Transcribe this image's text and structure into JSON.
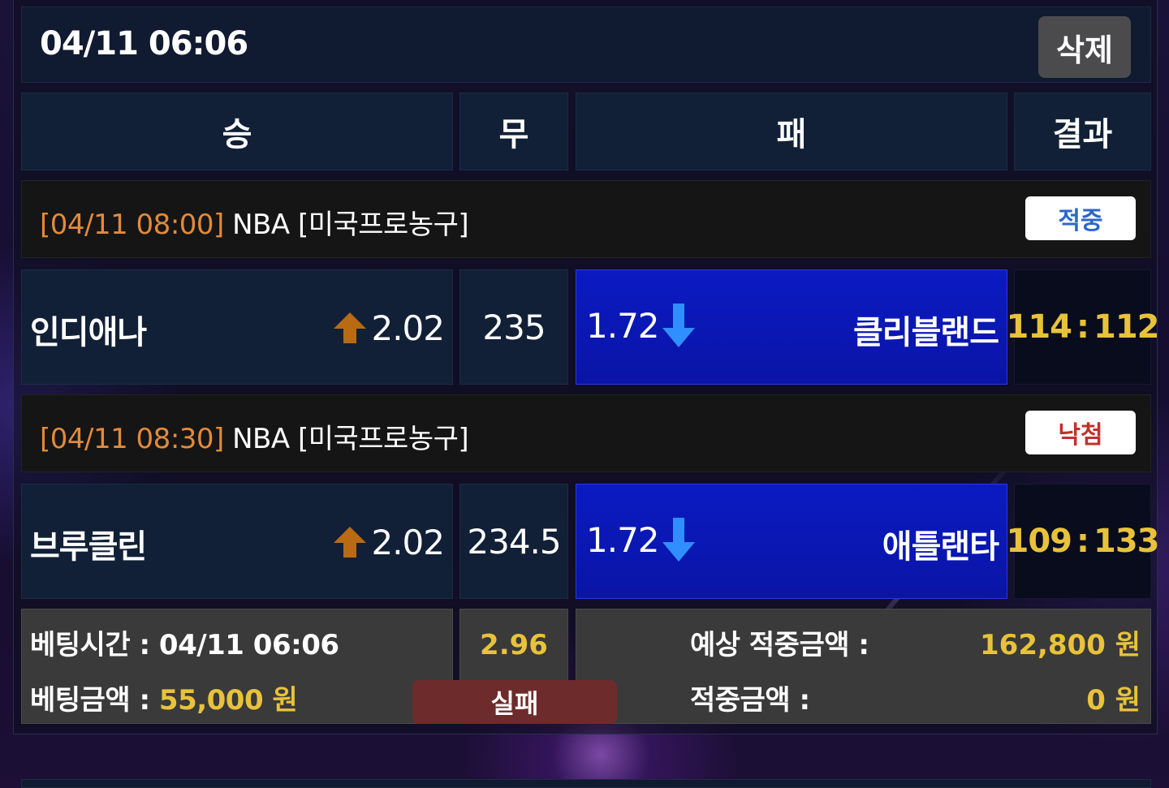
{
  "header": {
    "bet_datetime": "04/11 06:06",
    "delete_label": "삭제"
  },
  "columns": {
    "win": "승",
    "draw": "무",
    "lose": "패",
    "result": "결과"
  },
  "games": [
    {
      "kickoff": "[04/11 08:00]",
      "league": "NBA [미국프로농구]",
      "badge": "적중",
      "home_team": "인디애나",
      "home_odds": "2.02",
      "home_arrow": "up-arrow-icon",
      "line": "235",
      "away_odds": "1.72",
      "away_arrow": "down-arrow-icon",
      "away_team": "클리블랜드",
      "score_home": "114",
      "score_sep": ":",
      "score_away": "112",
      "selected": "away"
    },
    {
      "kickoff": "[04/11 08:30]",
      "league": "NBA [미국프로농구]",
      "badge": "낙첨",
      "home_team": "브루클린",
      "home_odds": "2.02",
      "home_arrow": "up-arrow-icon",
      "line": "234.5",
      "away_odds": "1.72",
      "away_arrow": "down-arrow-icon",
      "away_team": "애틀랜타",
      "score_home": "109",
      "score_sep": ":",
      "score_away": "133",
      "selected": "away"
    }
  ],
  "summary": {
    "bet_time_label": "베팅시간 :",
    "bet_time_value": "04/11 06:06",
    "bet_amount_label": "베팅금액 :",
    "bet_amount_value": "55,000 원",
    "total_odds": "2.96",
    "status": "실패",
    "expected_label": "예상 적중금액 :",
    "expected_value": "162,800 원",
    "won_label": "적중금액 :",
    "won_value": "0 원"
  },
  "colors": {
    "accent_gold": "#e8c23a",
    "time_orange": "#e28a3a",
    "selected_blue": "#0a16b4",
    "hit_blue": "#2c67c9",
    "miss_red": "#c0312c",
    "status_fail": "#6e2b2b"
  }
}
